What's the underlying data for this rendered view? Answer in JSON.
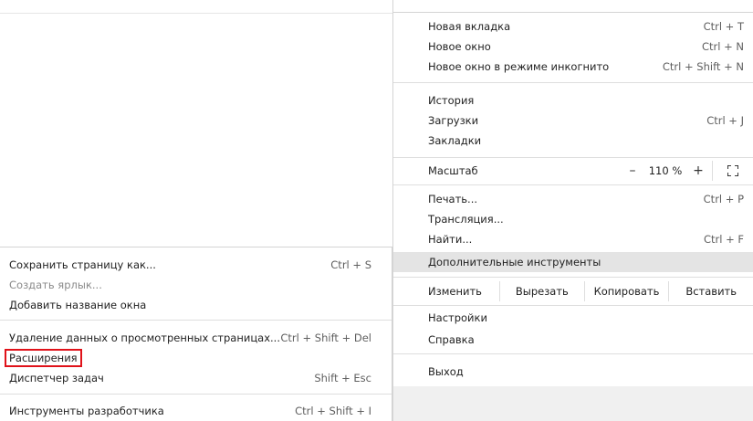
{
  "main_menu": {
    "new_tab": {
      "label": "Новая вкладка",
      "shortcut": "Ctrl + T"
    },
    "new_window": {
      "label": "Новое окно",
      "shortcut": "Ctrl + N"
    },
    "incognito": {
      "label": "Новое окно в режиме инкогнито",
      "shortcut": "Ctrl + Shift + N"
    },
    "history": {
      "label": "История"
    },
    "downloads": {
      "label": "Загрузки",
      "shortcut": "Ctrl + J"
    },
    "bookmarks": {
      "label": "Закладки"
    },
    "zoom": {
      "label": "Масштаб",
      "minus": "–",
      "value": "110 %",
      "plus": "+"
    },
    "print": {
      "label": "Печать...",
      "shortcut": "Ctrl + P"
    },
    "cast": {
      "label": "Трансляция..."
    },
    "find": {
      "label": "Найти...",
      "shortcut": "Ctrl + F"
    },
    "more_tools": {
      "label": "Дополнительные инструменты"
    },
    "edit": {
      "label": "Изменить",
      "cut": "Вырезать",
      "copy": "Копировать",
      "paste": "Вставить"
    },
    "settings": {
      "label": "Настройки"
    },
    "help": {
      "label": "Справка"
    },
    "exit": {
      "label": "Выход"
    }
  },
  "submenu": {
    "save_page": {
      "label": "Сохранить страницу как...",
      "shortcut": "Ctrl + S"
    },
    "create_shortcut": {
      "label": "Создать ярлык..."
    },
    "name_window": {
      "label": "Добавить название окна"
    },
    "clear_data": {
      "label": "Удаление данных о просмотренных страницах...",
      "shortcut": "Ctrl + Shift + Del"
    },
    "extensions": {
      "label": "Расширения"
    },
    "task_manager": {
      "label": "Диспетчер задач",
      "shortcut": "Shift + Esc"
    },
    "dev_tools": {
      "label": "Инструменты разработчика",
      "shortcut": "Ctrl + Shift + I"
    }
  },
  "colors": {
    "highlight_box": "#e0121a",
    "active_item_bg": "#e4e4e4"
  }
}
